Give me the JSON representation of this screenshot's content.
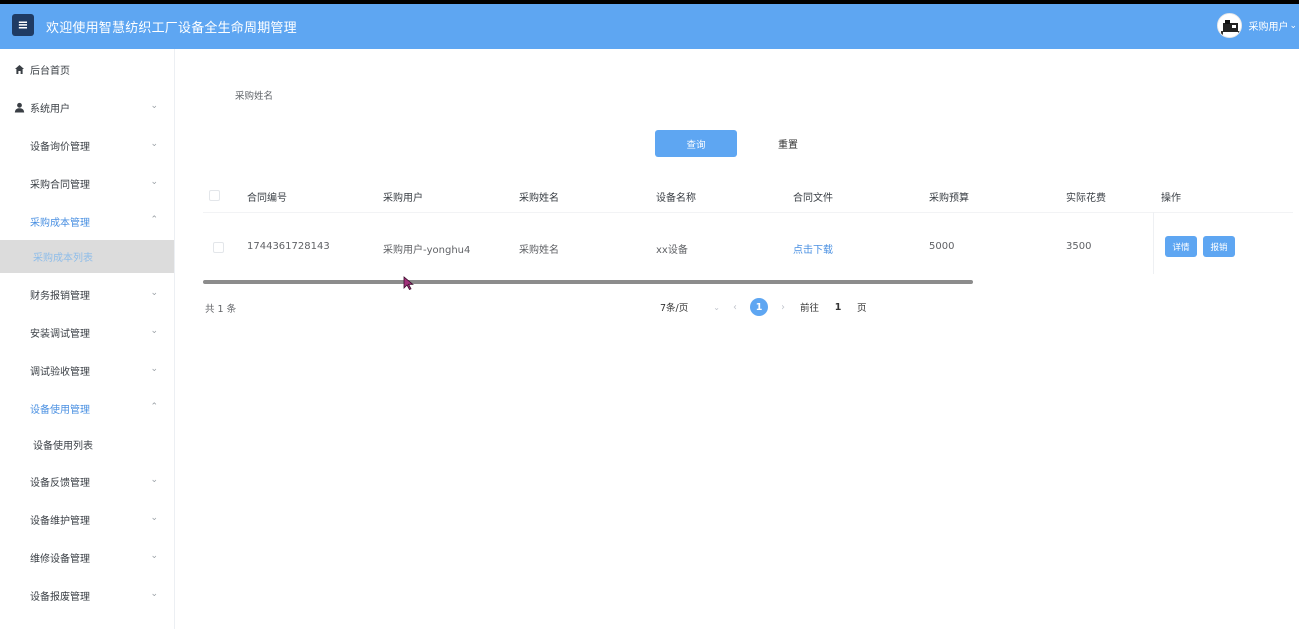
{
  "header": {
    "menu_icon_glyph": "≡",
    "title": "欢迎使用智慧纺织工厂设备全生命周期管理",
    "user_name": "采购用户",
    "user_chevron": "⌄"
  },
  "sidebar": {
    "items": [
      {
        "label": "后台首页",
        "icon": "home-icon"
      },
      {
        "label": "系统用户",
        "icon": "user-icon",
        "chevron": "⌄"
      },
      {
        "label": "设备询价管理",
        "icon": "grid-icon",
        "chevron": "⌄"
      },
      {
        "label": "采购合同管理",
        "icon": "grid-icon",
        "chevron": "⌄"
      },
      {
        "label": "采购成本管理",
        "icon": "grid-icon",
        "chevron": "⌃",
        "active": true
      },
      {
        "label": "采购成本列表",
        "sub": true,
        "selected": true
      },
      {
        "label": "财务报销管理",
        "icon": "grid-icon",
        "chevron": "⌄"
      },
      {
        "label": "安装调试管理",
        "icon": "grid-icon",
        "chevron": "⌄"
      },
      {
        "label": "调试验收管理",
        "icon": "grid-icon",
        "chevron": "⌄"
      },
      {
        "label": "设备使用管理",
        "icon": "grid-icon",
        "chevron": "⌃",
        "active": true
      },
      {
        "label": "设备使用列表",
        "sub": true
      },
      {
        "label": "设备反馈管理",
        "icon": "grid-icon",
        "chevron": "⌄"
      },
      {
        "label": "设备维护管理",
        "icon": "grid-icon",
        "chevron": "⌄"
      },
      {
        "label": "维修设备管理",
        "icon": "grid-icon",
        "chevron": "⌄"
      },
      {
        "label": "设备报废管理",
        "icon": "grid-icon",
        "chevron": "⌄"
      }
    ]
  },
  "filter": {
    "label": "采购姓名",
    "query_button": "查询",
    "reset_button": "重置"
  },
  "table": {
    "columns": [
      "合同编号",
      "采购用户",
      "采购姓名",
      "设备名称",
      "合同文件",
      "采购预算",
      "实际花费",
      "操作"
    ],
    "rows": [
      {
        "contract_no": "1744361728143",
        "buyer_user": "采购用户-yonghu4",
        "buyer_name": "采购姓名",
        "device_name": "xx设备",
        "contract_file": "点击下载",
        "budget": "5000",
        "actual_cost": "3500",
        "actions": [
          "详情",
          "报销"
        ]
      }
    ]
  },
  "pagination": {
    "total_text": "共 1 条",
    "page_size": "7条/页",
    "size_chevron": "⌄",
    "prev_glyph": "‹",
    "next_glyph": "›",
    "current_page": "1",
    "goto_prefix": "前往",
    "goto_value": "1",
    "goto_suffix": "页"
  },
  "colors": {
    "header_bg": "#5ea6f2",
    "primary": "#5ea6f2",
    "link": "#4a90e2",
    "selected_bg": "#dcdcdc"
  }
}
